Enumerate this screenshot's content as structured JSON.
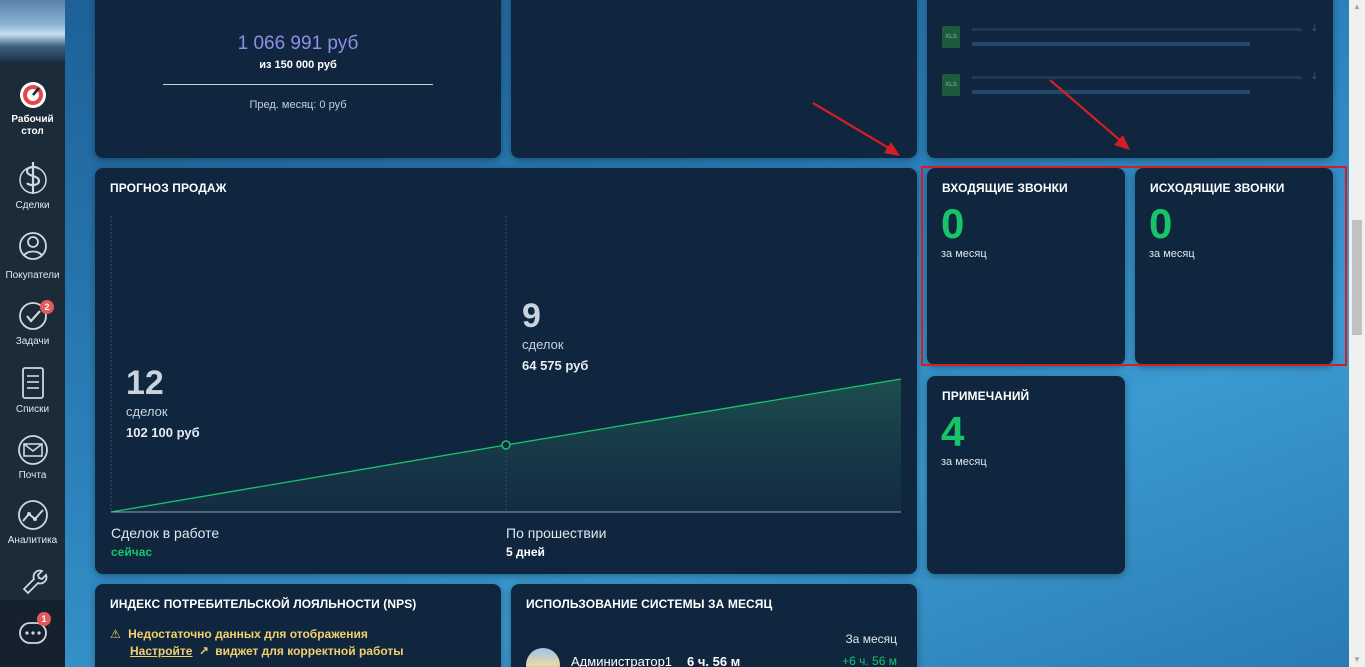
{
  "sidebar": {
    "items": [
      {
        "label": "Рабочий стол",
        "label_line1": "Рабочий",
        "label_line2": "стол",
        "icon": "dashboard-icon"
      },
      {
        "label": "Сделки",
        "icon": "dollar-icon"
      },
      {
        "label": "Покупатели",
        "icon": "customer-icon"
      },
      {
        "label": "Задачи",
        "icon": "tasks-check-icon",
        "badge": "2"
      },
      {
        "label": "Списки",
        "icon": "lists-icon"
      },
      {
        "label": "Почта",
        "icon": "mail-icon"
      },
      {
        "label": "Аналитика",
        "icon": "analytics-icon"
      },
      {
        "label": "",
        "icon": "settings-wrench-icon"
      }
    ],
    "chat_badge": "1"
  },
  "revenue_card": {
    "value": "1 066 991 руб",
    "subtitle": "из 150 000 руб",
    "prev_month": "Пред. месяц: 0 руб"
  },
  "forecast": {
    "title": "ПРОГНОЗ ПРОДАЖ",
    "now": {
      "count": "12",
      "label": "сделок",
      "sum": "102 100 руб"
    },
    "later": {
      "count": "9",
      "label": "сделок",
      "sum": "64 575 руб"
    },
    "bottom_left_label": "Сделок в работе",
    "bottom_left_value": "сейчас",
    "bottom_right_label": "По прошествии",
    "bottom_right_value": "5 дней"
  },
  "incoming_calls": {
    "title": "ВХОДЯЩИЕ ЗВОНКИ",
    "value": "0",
    "sub": "за месяц"
  },
  "outgoing_calls": {
    "title": "ИСХОДЯЩИЕ ЗВОНКИ",
    "value": "0",
    "sub": "за месяц"
  },
  "notes": {
    "title": "ПРИМЕЧАНИЙ",
    "value": "4",
    "sub": "за месяц"
  },
  "nps": {
    "title": "ИНДЕКС ПОТРЕБИТЕЛЬСКОЙ ЛОЯЛЬНОСТИ (NPS)",
    "warning": "Недостаточно данных для отображения",
    "setup_link": "Настройте",
    "warning_tail": "виджет для корректной работы"
  },
  "usage": {
    "title": "ИСПОЛЬЗОВАНИЕ СИСТЕМЫ ЗА МЕСЯЦ",
    "period": "За месяц",
    "user": "Администратор1",
    "time": "6 ч. 56 м",
    "delta": "+6 ч. 56 м"
  },
  "files": [
    {
      "type": "XLS"
    },
    {
      "type": "XLS"
    }
  ],
  "colors": {
    "accent_green": "#16c56a",
    "revenue_purple": "#8e8de8",
    "card_bg": "#10263e",
    "highlight_red": "#d41e25"
  }
}
